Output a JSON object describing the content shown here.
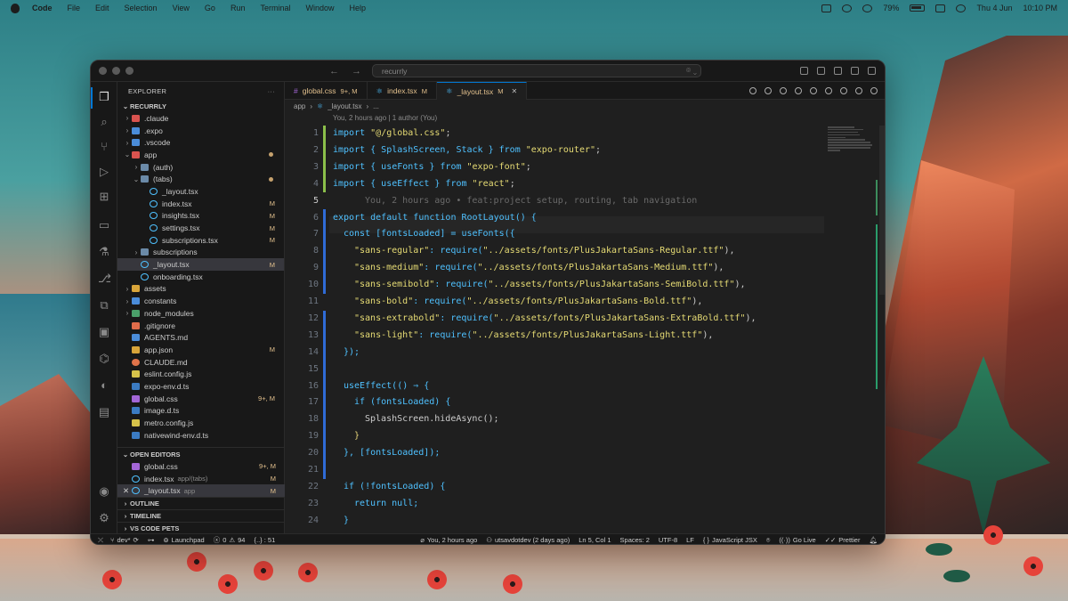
{
  "menubar": {
    "app": "Code",
    "items": [
      "File",
      "Edit",
      "Selection",
      "View",
      "Go",
      "Run",
      "Terminal",
      "Window",
      "Help"
    ],
    "battery": "79%",
    "date": "Thu 4 Jun",
    "time": "10:10 PM"
  },
  "titlebar": {
    "search": "recurrly"
  },
  "explorer": {
    "header": "EXPLORER",
    "project": "RECURRLY",
    "tree": [
      {
        "label": ".claude",
        "icon": "folder-red"
      },
      {
        "label": ".expo",
        "icon": "folder-blue",
        "dim": true
      },
      {
        "label": ".vscode",
        "icon": "folder-blue"
      },
      {
        "label": "app",
        "icon": "folder-red"
      },
      {
        "label": "(auth)",
        "icon": "folder"
      },
      {
        "label": "(tabs)",
        "icon": "folder"
      },
      {
        "label": "_layout.tsx",
        "icon": "tsx"
      },
      {
        "label": "index.tsx",
        "icon": "tsx",
        "badge": "M"
      },
      {
        "label": "insights.tsx",
        "icon": "tsx",
        "badge": "M"
      },
      {
        "label": "settings.tsx",
        "icon": "tsx",
        "badge": "M"
      },
      {
        "label": "subscriptions.tsx",
        "icon": "tsx",
        "badge": "M"
      },
      {
        "label": "subscriptions",
        "icon": "folder"
      },
      {
        "label": "_layout.tsx",
        "icon": "tsx",
        "badge": "M"
      },
      {
        "label": "onboarding.tsx",
        "icon": "tsx"
      },
      {
        "label": "assets",
        "icon": "folder-yellow"
      },
      {
        "label": "constants",
        "icon": "folder-blue"
      },
      {
        "label": "node_modules",
        "icon": "folder-green"
      },
      {
        "label": ".gitignore",
        "icon": "git"
      },
      {
        "label": "AGENTS.md",
        "icon": "md"
      },
      {
        "label": "app.json",
        "icon": "json",
        "badge": "M"
      },
      {
        "label": "CLAUDE.md",
        "icon": "star"
      },
      {
        "label": "eslint.config.js",
        "icon": "js"
      },
      {
        "label": "expo-env.d.ts",
        "icon": "dts"
      },
      {
        "label": "global.css",
        "icon": "css",
        "badge": "9+, M"
      },
      {
        "label": "image.d.ts",
        "icon": "dts"
      },
      {
        "label": "metro.config.js",
        "icon": "js"
      },
      {
        "label": "nativewind-env.d.ts",
        "icon": "dts"
      }
    ],
    "open_editors_title": "OPEN EDITORS",
    "open_editors": [
      {
        "label": "global.css",
        "path": "",
        "badge": "9+, M"
      },
      {
        "label": "index.tsx",
        "path": "app/(tabs)",
        "badge": "M"
      },
      {
        "label": "_layout.tsx",
        "path": "app",
        "badge": "M"
      }
    ],
    "outline": "OUTLINE",
    "timeline": "TIMELINE",
    "pets": "VS CODE PETS"
  },
  "tabs": [
    {
      "label": "global.css",
      "badge": "9+, M"
    },
    {
      "label": "index.tsx",
      "badge": "M"
    },
    {
      "label": "_layout.tsx",
      "badge": "M"
    }
  ],
  "breadcrumb": {
    "folder": "app",
    "file": "_layout.tsx",
    "rest": "..."
  },
  "blame": "You, 2 hours ago | 1 author (You)",
  "code": {
    "l1": [
      "import ",
      "\"@/global.css\"",
      ";"
    ],
    "l2": [
      "import { SplashScreen, Stack } from ",
      "\"expo-router\"",
      ";"
    ],
    "l3": [
      "import { useFonts } from ",
      "\"expo-font\"",
      ";"
    ],
    "l4": [
      "import { useEffect } from ",
      "\"react\"",
      ";"
    ],
    "l5": "You, 2 hours ago • feat:project setup, routing, tab navigation",
    "l6": "export default function RootLayout() {",
    "l7": "const [fontsLoaded] = useFonts({",
    "l8": [
      "\"sans-regular\"",
      ": require(",
      "\"../assets/fonts/PlusJakartaSans-Regular.ttf\"",
      "),"
    ],
    "l9": [
      "\"sans-medium\"",
      ": require(",
      "\"../assets/fonts/PlusJakartaSans-Medium.ttf\"",
      "),"
    ],
    "l10": [
      "\"sans-semibold\"",
      ": require(",
      "\"../assets/fonts/PlusJakartaSans-SemiBold.ttf\"",
      "),"
    ],
    "l11": [
      "\"sans-bold\"",
      ": require(",
      "\"../assets/fonts/PlusJakartaSans-Bold.ttf\"",
      "),"
    ],
    "l12": [
      "\"sans-extrabold\"",
      ": require(",
      "\"../assets/fonts/PlusJakartaSans-ExtraBold.ttf\"",
      "),"
    ],
    "l13": [
      "\"sans-light\"",
      ": require(",
      "\"../assets/fonts/PlusJakartaSans-Light.ttf\"",
      "),"
    ],
    "l14": "});",
    "l16": "useEffect(() ⇒ {",
    "l17": "if (fontsLoaded) {",
    "l18": "SplashScreen.hideAsync();",
    "l19": "}",
    "l20": "}, [fontsLoaded]);",
    "l22": "if (!fontsLoaded) {",
    "l23": "return null;",
    "l24": "}"
  },
  "status": {
    "branch": "dev*",
    "launchpad": "Launchpad",
    "errors": "0",
    "warnings": "94",
    "ports": "{..} : 51",
    "blame": "You, 2 hours ago",
    "author": "utsavdotdev (2 days ago)",
    "position": "Ln 5, Col 1",
    "spaces": "Spaces: 2",
    "encoding": "UTF-8",
    "eol": "LF",
    "language": "JavaScript JSX",
    "golive": "Go Live",
    "prettier": "Prettier"
  }
}
